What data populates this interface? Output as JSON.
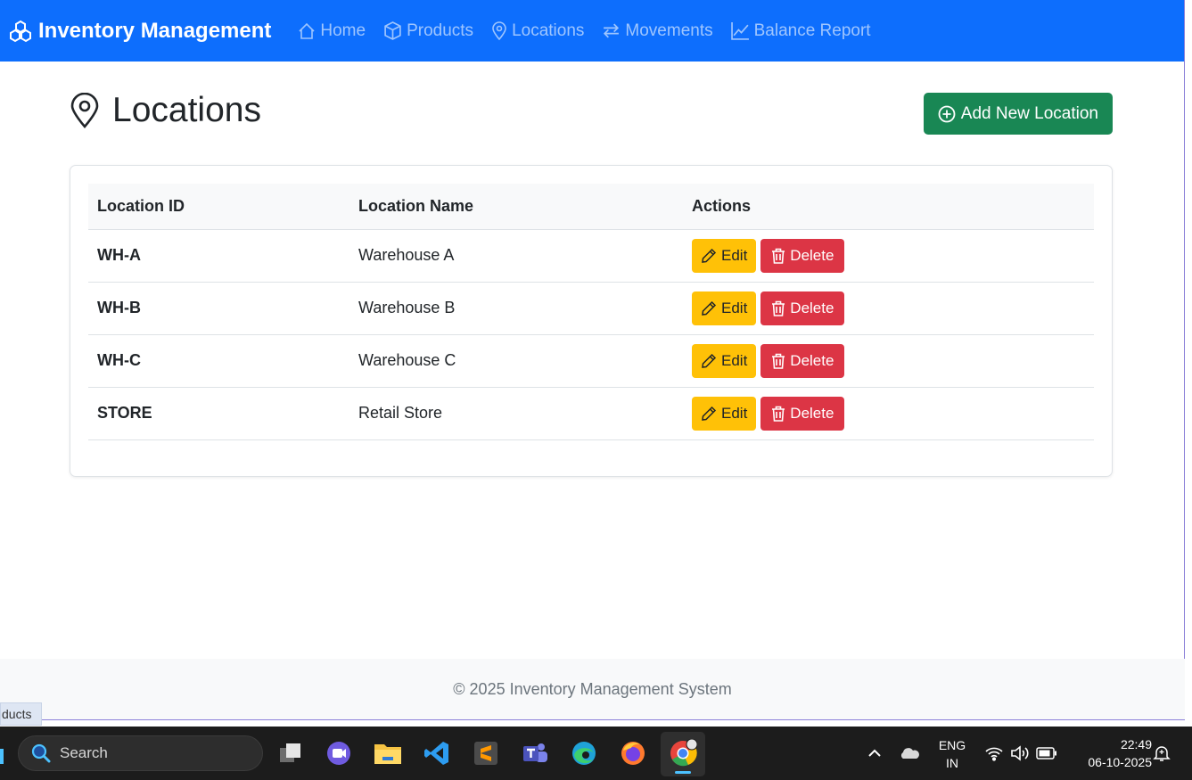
{
  "navbar": {
    "brand": "Inventory Management",
    "links": [
      {
        "label": "Home",
        "icon": "house-icon"
      },
      {
        "label": "Products",
        "icon": "box-icon"
      },
      {
        "label": "Locations",
        "icon": "geo-pin-icon"
      },
      {
        "label": "Movements",
        "icon": "arrow-left-right-icon"
      },
      {
        "label": "Balance Report",
        "icon": "graph-up-icon"
      }
    ]
  },
  "page": {
    "title": "Locations",
    "add_button": "Add New Location"
  },
  "table": {
    "headers": [
      "Location ID",
      "Location Name",
      "Actions"
    ],
    "rows": [
      {
        "id": "WH-A",
        "name": "Warehouse A"
      },
      {
        "id": "WH-B",
        "name": "Warehouse B"
      },
      {
        "id": "WH-C",
        "name": "Warehouse C"
      },
      {
        "id": "STORE",
        "name": "Retail Store"
      }
    ],
    "edit_label": "Edit",
    "delete_label": "Delete"
  },
  "footer": {
    "text": "© 2025 Inventory Management System"
  },
  "status_bar": {
    "link_preview": "ducts"
  },
  "taskbar": {
    "search_label": "Search",
    "lang_line1": "ENG",
    "lang_line2": "IN",
    "time": "22:49",
    "date": "06-10-2025"
  },
  "colors": {
    "primary": "#0d6efd",
    "success": "#198754",
    "warning": "#ffc107",
    "danger": "#dc3545"
  }
}
